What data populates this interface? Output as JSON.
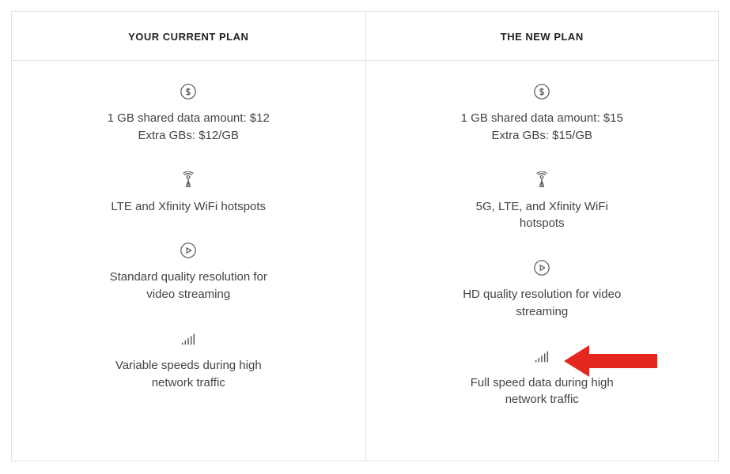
{
  "columns": [
    {
      "header": "YOUR CURRENT PLAN",
      "features": [
        {
          "icon": "dollar-icon",
          "line1": "1 GB shared data amount: $12",
          "line2": "Extra GBs: $12/GB"
        },
        {
          "icon": "tower-icon",
          "line1": "LTE and Xfinity WiFi hotspots",
          "line2": ""
        },
        {
          "icon": "play-icon",
          "line1": "Standard quality resolution for",
          "line2": "video streaming"
        },
        {
          "icon": "signal-icon",
          "line1": "Variable speeds during high",
          "line2": "network traffic"
        }
      ]
    },
    {
      "header": "THE NEW PLAN",
      "features": [
        {
          "icon": "dollar-icon",
          "line1": "1 GB shared data amount: $15",
          "line2": "Extra GBs: $15/GB"
        },
        {
          "icon": "tower-icon",
          "line1": "5G, LTE, and Xfinity WiFi",
          "line2": "hotspots"
        },
        {
          "icon": "play-icon",
          "line1": "HD quality resolution for video",
          "line2": "streaming"
        },
        {
          "icon": "signal-icon",
          "line1": "Full speed data during high",
          "line2": "network traffic",
          "arrow": true
        }
      ]
    }
  ]
}
